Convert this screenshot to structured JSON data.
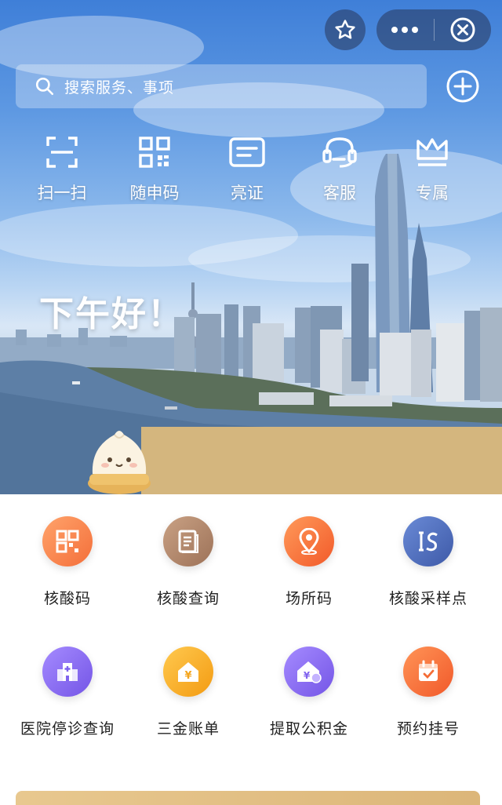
{
  "topbar": {
    "favorite_icon": "star-icon",
    "more_icon": "more-dots-icon",
    "close_icon": "close-circle-icon"
  },
  "search": {
    "placeholder": "搜索服务、事项",
    "icon": "search-icon",
    "add_icon": "plus-circle-icon"
  },
  "tools": [
    {
      "label": "扫一扫",
      "icon": "scan-icon"
    },
    {
      "label": "随申码",
      "icon": "qr-code-icon"
    },
    {
      "label": "亮证",
      "icon": "id-card-icon"
    },
    {
      "label": "客服",
      "icon": "headset-icon"
    },
    {
      "label": "专属",
      "icon": "crown-icon"
    }
  ],
  "greeting": "下午好！",
  "services": [
    {
      "label": "核酸码",
      "icon": "qr-code-icon",
      "color": "#f58a4e"
    },
    {
      "label": "核酸查询",
      "icon": "document-icon",
      "color": "#b58a6c"
    },
    {
      "label": "场所码",
      "icon": "location-pin-icon",
      "color": "#f4763b"
    },
    {
      "label": "核酸采样点",
      "icon": "sampling-logo-icon",
      "color": "#4d6fbf"
    },
    {
      "label": "医院停诊查询",
      "icon": "hospital-icon",
      "color": "#8a6cf0"
    },
    {
      "label": "三金账单",
      "icon": "yen-house-icon",
      "color": "#f7ad2c"
    },
    {
      "label": "提取公积金",
      "icon": "yen-home-fund-icon",
      "color": "#8a6cf0"
    },
    {
      "label": "预约挂号",
      "icon": "calendar-icon",
      "color": "#f47138"
    }
  ],
  "colors": {
    "mascot_bar": "#d4b67e",
    "banner": "#e2c085"
  }
}
